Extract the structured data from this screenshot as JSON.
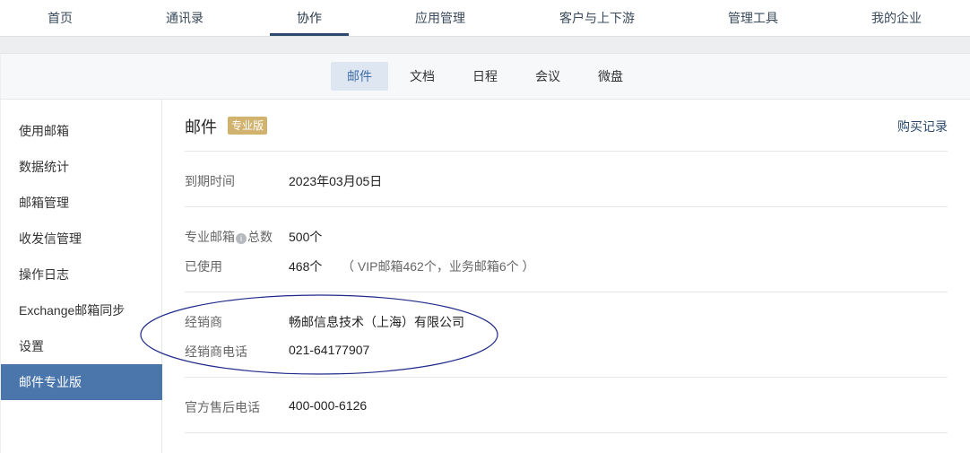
{
  "topnav": {
    "items": [
      "首页",
      "通讯录",
      "协作",
      "应用管理",
      "客户与上下游",
      "管理工具",
      "我的企业"
    ],
    "active_index": 2
  },
  "subnav": {
    "tabs": [
      "邮件",
      "文档",
      "日程",
      "会议",
      "微盘"
    ],
    "active_index": 0
  },
  "sidebar": {
    "items": [
      "使用邮箱",
      "数据统计",
      "邮箱管理",
      "收发信管理",
      "操作日志",
      "Exchange邮箱同步",
      "设置",
      "邮件专业版"
    ],
    "active_index": 7
  },
  "content": {
    "title": "邮件",
    "badge": "专业版",
    "buy_link": "购买记录",
    "expiry_label": "到期时间",
    "expiry_value": "2023年03月05日",
    "total_label_a": "专业邮箱",
    "total_label_b": "总数",
    "total_value": "500个",
    "used_label": "已使用",
    "used_value": "468个",
    "used_note": "（ VIP邮箱462个，业务邮箱6个 ）",
    "dealer_label": "经销商",
    "dealer_value": "畅邮信息技术（上海）有限公司",
    "dealer_phone_label": "经销商电话",
    "dealer_phone_value": "021-64177907",
    "support_label": "官方售后电话",
    "support_value": "400-000-6126"
  },
  "colors": {
    "sidebar_active_bg": "#4a76ac",
    "badge_bg": "#d2b26f",
    "annotation_ellipse": "#1f2a8a"
  }
}
